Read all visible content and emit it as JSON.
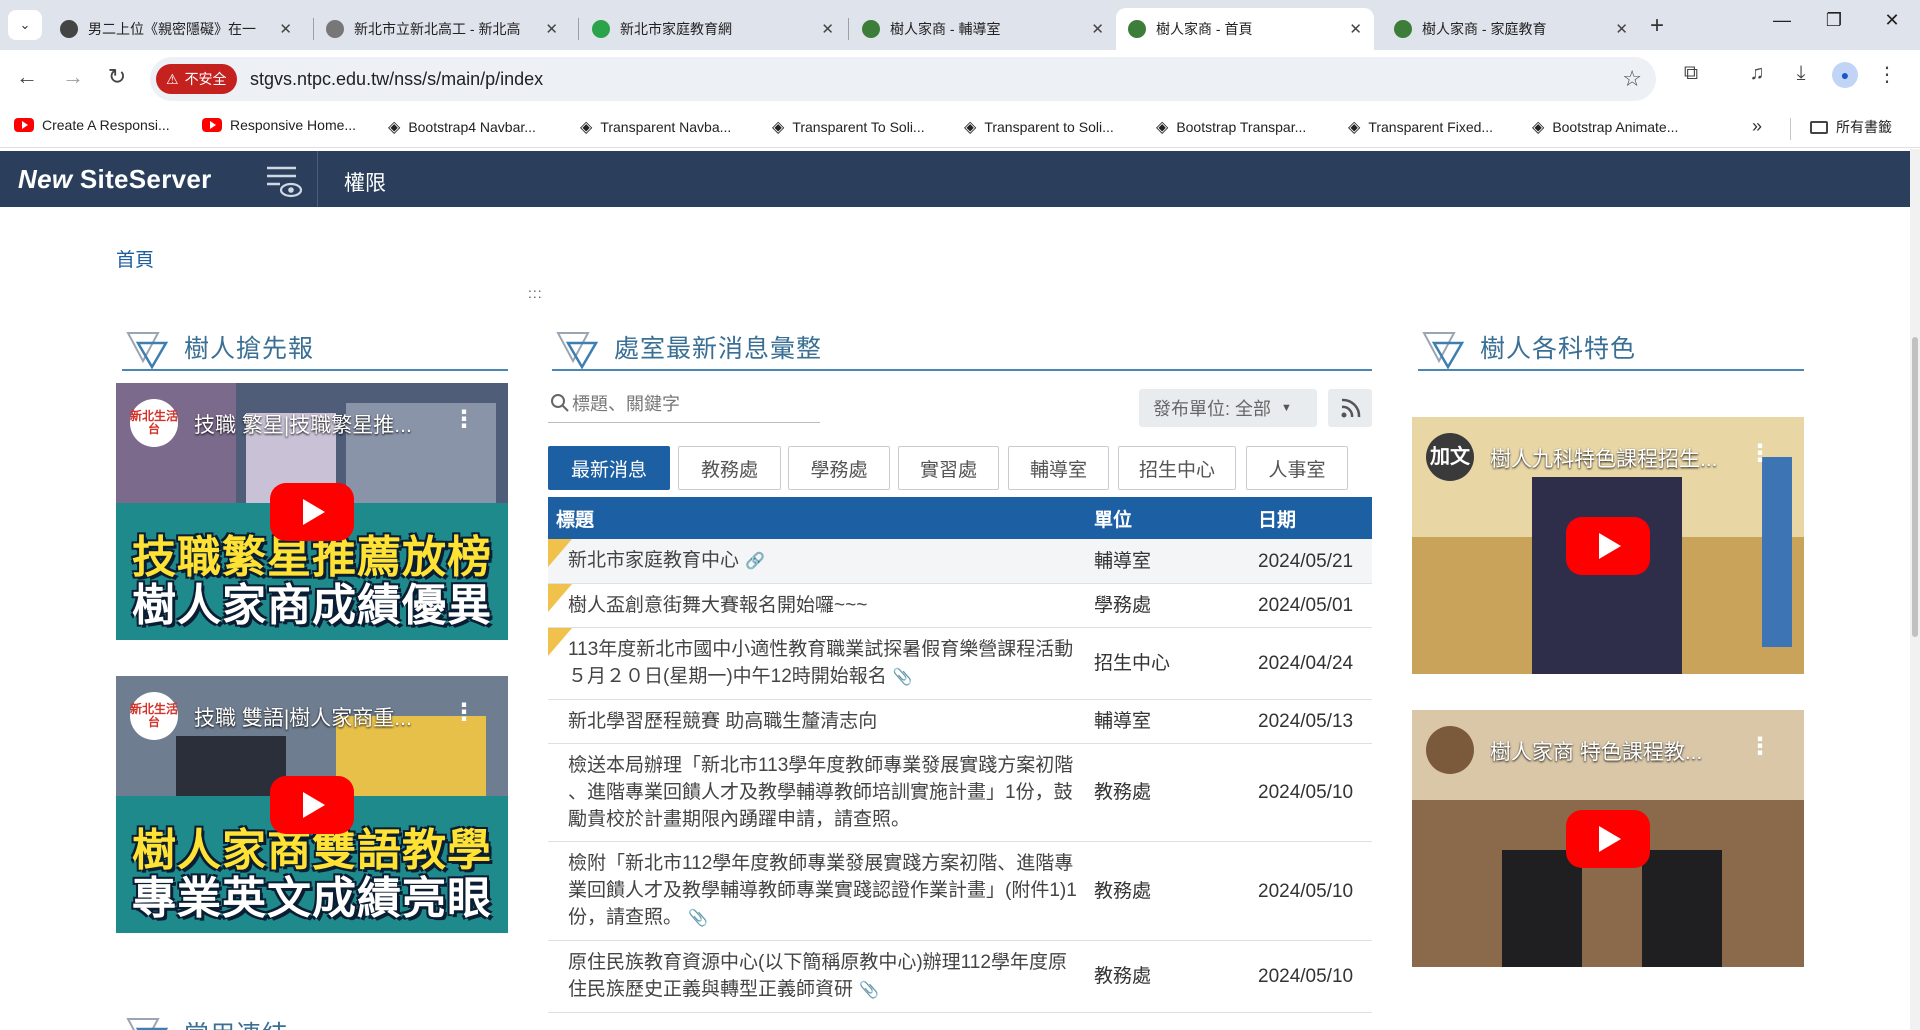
{
  "browser": {
    "tabs": [
      {
        "title": "男二上位《親密隱礙》在一",
        "icon_color": "#444"
      },
      {
        "title": "新北市立新北高工 - 新北高",
        "icon_color": "#666"
      },
      {
        "title": "新北市家庭教育網",
        "icon_color": "#2aa34a"
      },
      {
        "title": "樹人家商 - 輔導室",
        "icon_color": "#3c7d3a"
      },
      {
        "title": "樹人家商 - 首頁",
        "icon_color": "#3c7d3a"
      },
      {
        "title": "樹人家商 - 家庭教育",
        "icon_color": "#3c7d3a"
      }
    ],
    "security_label": "不安全",
    "url": "stgvs.ntpc.edu.tw/nss/s/main/p/index",
    "bookmarks": [
      {
        "label": "Create A Responsi...",
        "icon": "youtube-icon"
      },
      {
        "label": "Responsive Home...",
        "icon": "youtube-icon"
      },
      {
        "label": "Bootstrap4 Navbar...",
        "icon": "bootstrap-icon"
      },
      {
        "label": "Transparent Navba...",
        "icon": "bootstrap-icon"
      },
      {
        "label": "Transparent To Soli...",
        "icon": "bootstrap-icon"
      },
      {
        "label": "Transparent to Soli...",
        "icon": "bootstrap-icon"
      },
      {
        "label": "Bootstrap Transpar...",
        "icon": "bootstrap-icon"
      },
      {
        "label": "Transparent Fixed...",
        "icon": "bootstrap-icon"
      },
      {
        "label": "Bootstrap Animate...",
        "icon": "bootstrap-icon"
      }
    ],
    "all_bookmarks_label": "所有書籤"
  },
  "site": {
    "logo_word1": "New",
    "logo_word2": "SiteServer",
    "nav_link": "權限",
    "breadcrumb": "首頁",
    "dots": ":::",
    "colors": {
      "navbar": "#2b3f5c",
      "accent": "#1c5fa3",
      "heading": "#3a6f95",
      "pin": "#f0c14b"
    }
  },
  "left": {
    "title": "樹人搶先報",
    "videos": [
      {
        "channel": "新北生活台",
        "title": "技職 繁星|技職繁星推...",
        "cap1": "技職繁星推薦放榜",
        "cap2": "樹人家商成績優異"
      },
      {
        "channel": "新北生活台",
        "title": "技職 雙語|樹人家商重...",
        "cap1": "樹人家商雙語教學",
        "cap2": "專業英文成績亮眼"
      }
    ]
  },
  "center": {
    "title": "處室最新消息彙整",
    "search_placeholder": "標題、關鍵字",
    "filter_label": "發布單位: 全部",
    "tabs": [
      "最新消息",
      "教務處",
      "學務處",
      "實習處",
      "輔導室",
      "招生中心",
      "人事室"
    ],
    "columns": [
      "標題",
      "單位",
      "日期"
    ],
    "rows": [
      {
        "title": "新北市家庭教育中心",
        "unit": "輔導室",
        "date": "2024/05/21",
        "pinned": true,
        "mark": "link"
      },
      {
        "title": "樹人盃創意街舞大賽報名開始囉~~~",
        "unit": "學務處",
        "date": "2024/05/01",
        "pinned": true,
        "mark": ""
      },
      {
        "title": "113年度新北市國中小適性教育職業試探暑假育樂營課程活動５月２０日(星期一)中午12時開始報名",
        "unit": "招生中心",
        "date": "2024/04/24",
        "pinned": true,
        "mark": "attach"
      },
      {
        "title": "新北學習歷程競賽 助高職生釐清志向",
        "unit": "輔導室",
        "date": "2024/05/13",
        "pinned": false,
        "mark": ""
      },
      {
        "title": "檢送本局辦理「新北市113學年度教師專業發展實踐方案初階 、進階專業回饋人才及教學輔導教師培訓實施計畫」1份，鼓勵貴校於計畫期限內踴躍申請，請查照。",
        "unit": "教務處",
        "date": "2024/05/10",
        "pinned": false,
        "mark": ""
      },
      {
        "title": "檢附「新北市112學年度教師專業發展實踐方案初階、進階專業回饋人才及教學輔導教師專業實踐認證作業計畫」(附件1)1份，請查照。",
        "unit": "教務處",
        "date": "2024/05/10",
        "pinned": false,
        "mark": "attach"
      },
      {
        "title": "原住民族教育資源中心(以下簡稱原教中心)辦理112學年度原住民族歷史正義與轉型正義師資研",
        "unit": "教務處",
        "date": "2024/05/10",
        "pinned": false,
        "mark": "attach"
      }
    ]
  },
  "right": {
    "title": "樹人各科特色",
    "videos": [
      {
        "channel": "加文",
        "title": "樹人九科特色課程招生..."
      },
      {
        "channel": "",
        "title": "樹人家商 特色課程教..."
      }
    ]
  },
  "bottom_section_title": "常用連結"
}
